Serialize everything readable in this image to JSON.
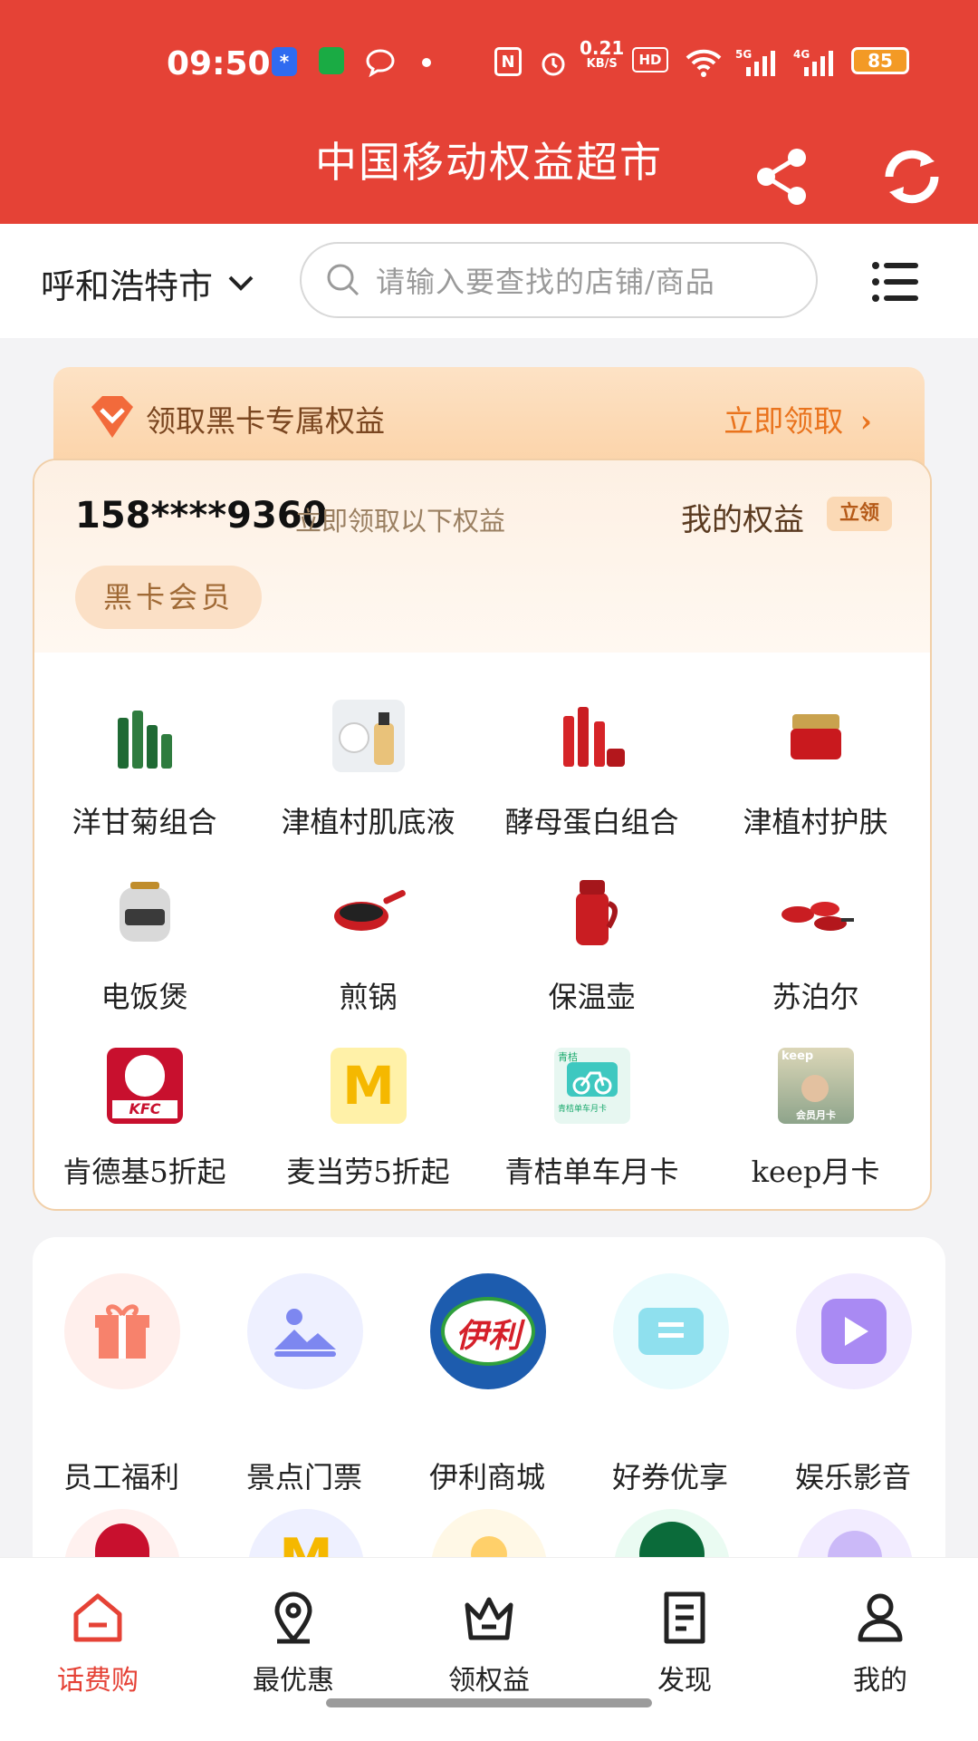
{
  "status_bar": {
    "time": "09:50",
    "net_speed": "0.21",
    "net_unit": "KB/S",
    "battery": "85"
  },
  "header": {
    "title": "中国移动权益超市",
    "share_icon": "share-icon",
    "refresh_icon": "refresh-icon"
  },
  "search": {
    "city": "呼和浩特市",
    "placeholder": "请输入要查找的店铺/商品"
  },
  "promo": {
    "text": "领取黑卡专属权益",
    "cta": "立即领取"
  },
  "benefits": {
    "phone": "158****9360",
    "subtitle": "立即领取以下权益",
    "my_benefits": "我的权益",
    "badge": "立领",
    "tier": "黑卡会员",
    "items": [
      {
        "label": "洋甘菊组合"
      },
      {
        "label": "津植村肌底液"
      },
      {
        "label": "酵母蛋白组合"
      },
      {
        "label": "津植村护肤"
      },
      {
        "label": "电饭煲"
      },
      {
        "label": "煎锅"
      },
      {
        "label": "保温壶"
      },
      {
        "label": "苏泊尔"
      },
      {
        "label": "肯德基5折起"
      },
      {
        "label": "麦当劳5折起"
      },
      {
        "label": "青桔单车月卡"
      },
      {
        "label": "keep月卡"
      }
    ],
    "logo_text": {
      "kfc": "KFC",
      "mcd": "M",
      "keep": "keep",
      "keep_card": "会员月卡",
      "qingju": "青桔",
      "qingju_card": "青桔单车月卡"
    }
  },
  "categories": {
    "items": [
      {
        "label": "员工福利"
      },
      {
        "label": "景点门票"
      },
      {
        "label": "伊利商城"
      },
      {
        "label": "好券优享"
      },
      {
        "label": "娱乐影音"
      }
    ],
    "yili_logo": "伊利"
  },
  "bottom_nav": {
    "items": [
      {
        "label": "话费购"
      },
      {
        "label": "最优惠"
      },
      {
        "label": "领权益"
      },
      {
        "label": "发现"
      },
      {
        "label": "我的"
      }
    ]
  },
  "colors": {
    "brand_red": "#e54236",
    "gold": "#e9731d"
  }
}
